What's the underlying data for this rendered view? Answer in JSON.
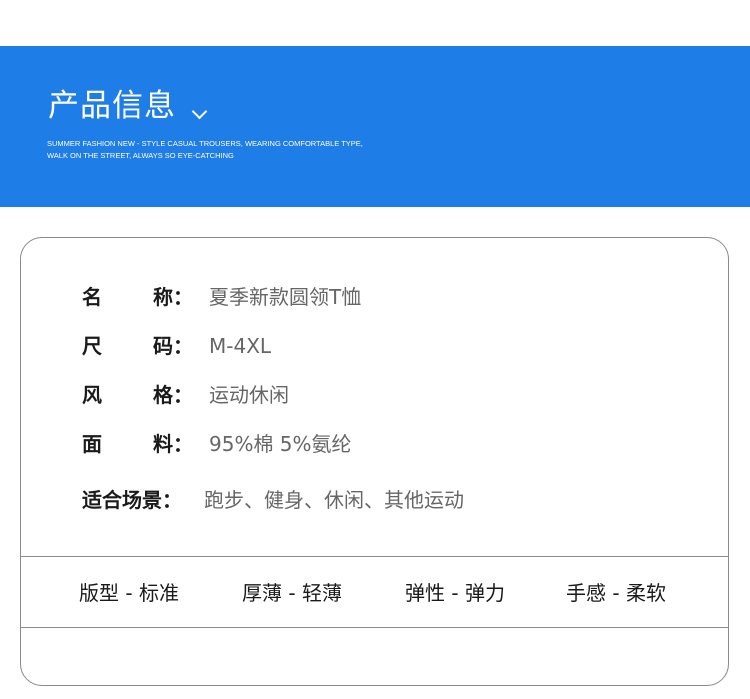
{
  "banner": {
    "title": "产品信息",
    "subtitle_line1": "SUMMER FASHION NEW - STYLE CASUAL TROUSERS, WEARING COMFORTABLE TYPE,",
    "subtitle_line2": "WALK ON THE STREET, ALWAYS SO EYE-CATCHING",
    "color": "#1e7de6",
    "icon": "chevron-down-icon"
  },
  "specs": [
    {
      "label_1": "名",
      "label_2": "称：",
      "value": "夏季新款圆领T恤"
    },
    {
      "label_1": "尺",
      "label_2": "码：",
      "value": "M-4XL"
    },
    {
      "label_1": "风",
      "label_2": "格：",
      "value": "运动休闲"
    },
    {
      "label_1": "面",
      "label_2": "料：",
      "value": "95%棉 5%氨纶"
    }
  ],
  "scene": {
    "label": "适合场景：",
    "value": "跑步、健身、休闲、其他运动"
  },
  "attributes": [
    "版型 - 标准",
    "厚薄 - 轻薄",
    "弹性 - 弹力",
    "手感 - 柔软"
  ]
}
